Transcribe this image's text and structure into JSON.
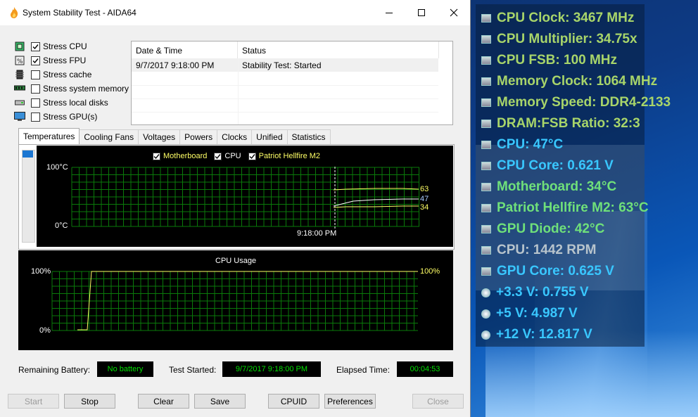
{
  "window": {
    "title": "System Stability Test - AIDA64"
  },
  "stress_options": [
    {
      "label": "Stress CPU",
      "checked": true,
      "icon": "cpu-chip-icon"
    },
    {
      "label": "Stress FPU",
      "checked": true,
      "icon": "fpu-chip-icon"
    },
    {
      "label": "Stress cache",
      "checked": false,
      "icon": "cache-chip-icon"
    },
    {
      "label": "Stress system memory",
      "checked": false,
      "icon": "memory-module-icon"
    },
    {
      "label": "Stress local disks",
      "checked": false,
      "icon": "disk-drive-icon"
    },
    {
      "label": "Stress GPU(s)",
      "checked": false,
      "icon": "monitor-icon"
    }
  ],
  "log": {
    "headers": [
      "Date & Time",
      "Status"
    ],
    "rows": [
      {
        "datetime": "9/7/2017 9:18:00 PM",
        "status": "Stability Test: Started"
      }
    ]
  },
  "tabs": [
    "Temperatures",
    "Cooling Fans",
    "Voltages",
    "Powers",
    "Clocks",
    "Unified",
    "Statistics"
  ],
  "temp_graph": {
    "legend": [
      {
        "label": "Motherboard",
        "color": "#ffff66"
      },
      {
        "label": "CPU",
        "color": "#ffffff"
      },
      {
        "label": "Patriot Hellfire M2",
        "color": "#ffff66"
      }
    ],
    "y_top": "100°C",
    "y_bottom": "0°C",
    "x_label": "9:18:00 PM",
    "readouts": [
      {
        "value": "63",
        "color": "#ffff66"
      },
      {
        "value": "47",
        "color": "#aaccff"
      },
      {
        "value": "34",
        "color": "#ffff66"
      }
    ]
  },
  "cpu_graph": {
    "title": "CPU Usage",
    "y_top": "100%",
    "y_bottom": "0%",
    "current": "100%"
  },
  "status": {
    "battery_label": "Remaining Battery:",
    "battery_value": "No battery",
    "started_label": "Test Started:",
    "started_value": "9/7/2017 9:18:00 PM",
    "elapsed_label": "Elapsed Time:",
    "elapsed_value": "00:04:53"
  },
  "buttons": {
    "start": "Start",
    "stop": "Stop",
    "clear": "Clear",
    "save": "Save",
    "cpuid": "CPUID",
    "preferences": "Preferences",
    "close": "Close"
  },
  "osd": [
    {
      "text": "CPU Clock: 3467 MHz",
      "color": "#a8d56a"
    },
    {
      "text": "CPU Multiplier: 34.75x",
      "color": "#a8d56a"
    },
    {
      "text": "CPU FSB: 100 MHz",
      "color": "#a8d56a"
    },
    {
      "text": "Memory Clock: 1064 MHz",
      "color": "#a8d56a"
    },
    {
      "text": "Memory Speed: DDR4-2133",
      "color": "#a8d56a"
    },
    {
      "text": "DRAM:FSB Ratio: 32:3",
      "color": "#a8d56a"
    },
    {
      "text": "CPU: 47°C",
      "color": "#39c7ff"
    },
    {
      "text": "CPU Core: 0.621 V",
      "color": "#39c7ff"
    },
    {
      "text": "Motherboard: 34°C",
      "color": "#6fe07a"
    },
    {
      "text": "Patriot Hellfire M2: 63°C",
      "color": "#6fe07a"
    },
    {
      "text": "GPU Diode: 42°C",
      "color": "#6fe07a"
    },
    {
      "text": "CPU: 1442 RPM",
      "color": "#b8c4cc"
    },
    {
      "text": "GPU Core: 0.625 V",
      "color": "#39c7ff"
    },
    {
      "text": "+3.3 V: 0.755 V",
      "color": "#39c7ff"
    },
    {
      "text": "+5 V: 4.987 V",
      "color": "#39c7ff"
    },
    {
      "text": "+12 V: 12.817 V",
      "color": "#39c7ff"
    }
  ]
}
